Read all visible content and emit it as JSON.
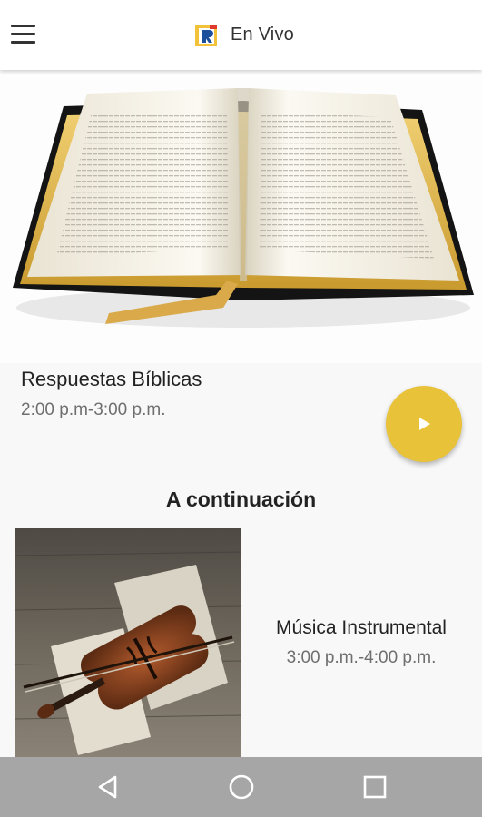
{
  "app_bar": {
    "title": "En Vivo",
    "menu_icon": "hamburger-menu-icon",
    "logo_icon": "radio-logo-icon"
  },
  "now_playing": {
    "hero_image": "open-bible-image",
    "program_title": "Respuestas Bíblicas",
    "time": "2:00 p.m-3:00 p.m.",
    "play_icon": "play-icon"
  },
  "up_next": {
    "heading": "A continuación",
    "thumbnail": "violin-image",
    "program_title": "Música Instrumental",
    "time": "3:00 p.m.-4:00 p.m."
  },
  "navigation_bar": {
    "back_icon": "back-triangle-icon",
    "home_icon": "home-circle-icon",
    "recents_icon": "recents-square-icon"
  },
  "colors": {
    "accent": "#e8c238",
    "background": "#f8f8f8",
    "nav_bar": "#a6a6a6",
    "text_primary": "#222222",
    "text_secondary": "#6f6f6f"
  }
}
